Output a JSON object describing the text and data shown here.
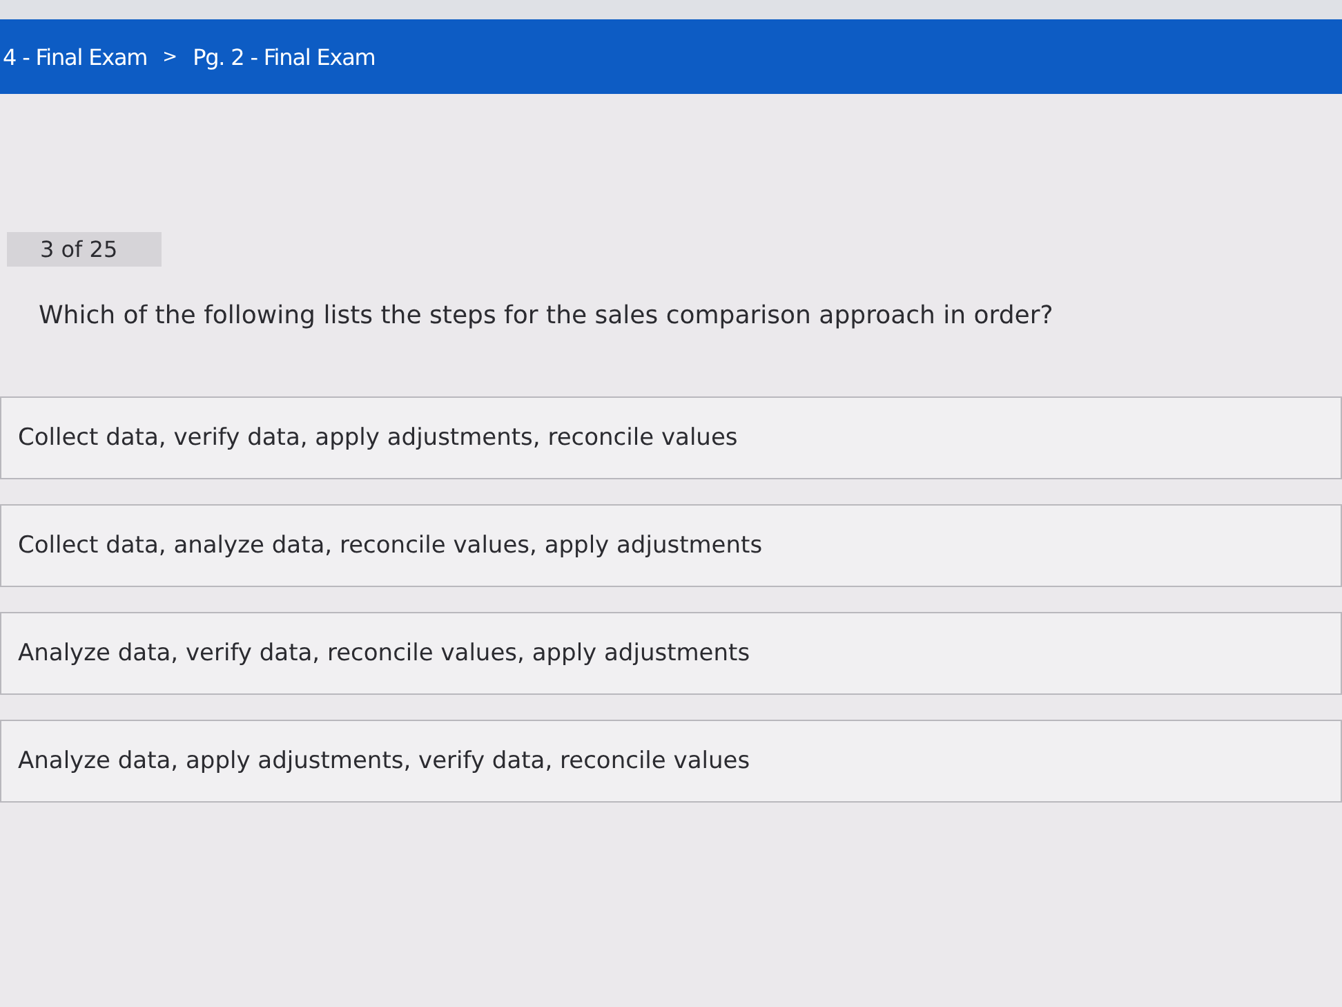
{
  "breadcrumb": {
    "items": [
      "4 - Final Exam",
      "Pg. 2 - Final Exam"
    ],
    "separator": ">"
  },
  "question": {
    "counter": "3 of 25",
    "text": "Which of the following lists the steps for the sales comparison approach in order?"
  },
  "options": [
    "Collect data, verify data, apply adjustments, reconcile values",
    "Collect data, analyze data, reconcile values, apply adjustments",
    "Analyze data, verify data, reconcile values, apply adjustments",
    "Analyze data, apply adjustments, verify data, reconcile values"
  ]
}
